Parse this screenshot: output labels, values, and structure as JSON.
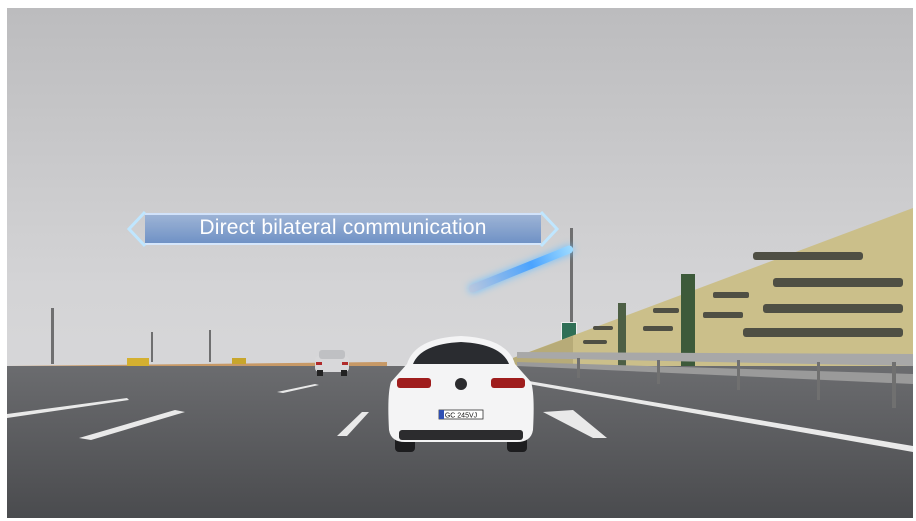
{
  "banner": {
    "text": "Direct bilateral communication",
    "icon_left": "chevron-left-icon",
    "icon_right": "chevron-right-icon"
  },
  "vehicle": {
    "plate": "GC 245VJ"
  },
  "colors": {
    "banner_fill": "#7a9fd2",
    "beam": "#4aa3ff",
    "sky": "#d2d2d4",
    "road": "#55565a"
  }
}
